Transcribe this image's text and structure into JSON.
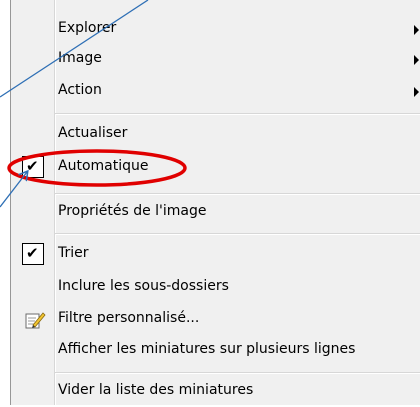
{
  "menu": {
    "items": [
      {
        "label": "Explorer"
      },
      {
        "label": "Image"
      },
      {
        "label": "Action"
      },
      {
        "label": "Actualiser"
      },
      {
        "label": "Automatique",
        "checked": true
      },
      {
        "label": "Propriétés de l'image"
      },
      {
        "label": "Trier",
        "checked": true
      },
      {
        "label": "Inclure les sous-dossiers"
      },
      {
        "label": "Filtre personnalisé...",
        "icon": "edit-filter-icon"
      },
      {
        "label": "Afficher les miniatures sur plusieurs lignes"
      },
      {
        "label": "Vider la liste des miniatures"
      }
    ],
    "check_mark": "✔"
  },
  "annotation": {
    "highlight_color": "#e00000",
    "arrow_color": "#2e6fb5"
  }
}
